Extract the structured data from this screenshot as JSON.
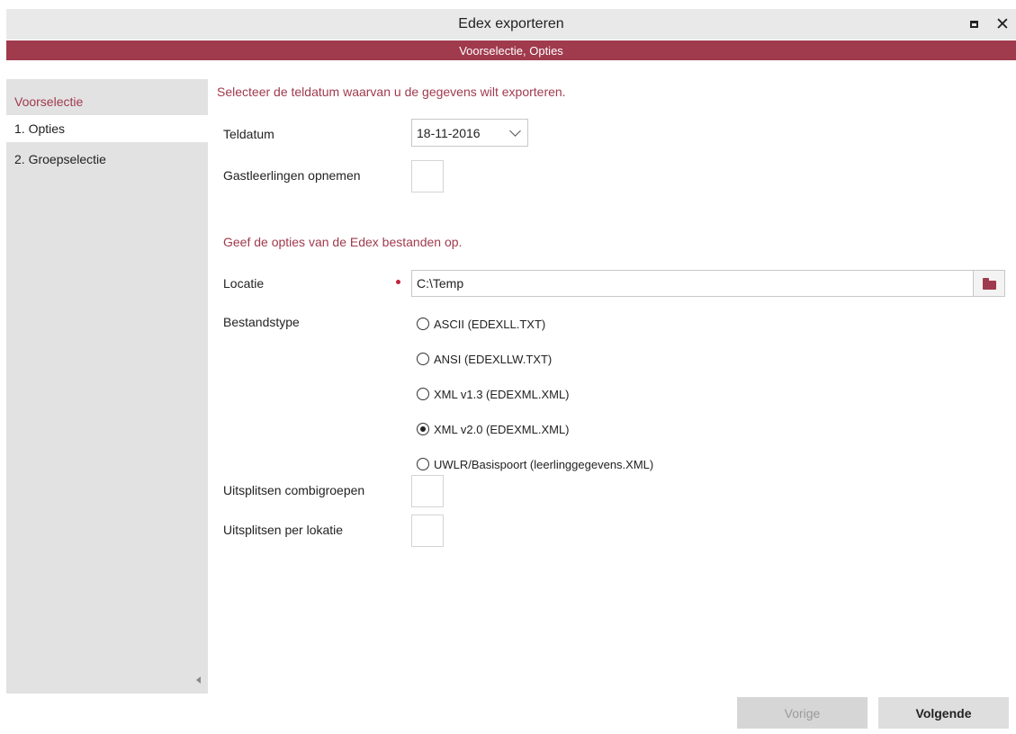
{
  "window": {
    "title": "Edex exporteren",
    "subtitle": "Voorselectie, Opties",
    "accent_color": "#a03a4d"
  },
  "sidebar": {
    "heading": "Voorselectie",
    "items": [
      {
        "label": "1. Opties",
        "active": true
      },
      {
        "label": "2. Groepselectie",
        "active": false
      }
    ]
  },
  "main": {
    "section1_title": "Selecteer de teldatum waarvan u de gegevens wilt exporteren.",
    "teldatum_label": "Teldatum",
    "teldatum_value": "18-11-2016",
    "gastleerlingen_label": "Gastleerlingen opnemen",
    "gastleerlingen_checked": false,
    "section2_title": "Geef de opties van de Edex bestanden op.",
    "locatie_label": "Locatie",
    "locatie_value": "C:\\Temp",
    "locatie_required": true,
    "bestandstype_label": "Bestandstype",
    "bestandstype_options": [
      {
        "label": "ASCII  (EDEXLL.TXT)",
        "checked": false
      },
      {
        "label": "ANSI   (EDEXLLW.TXT)",
        "checked": false
      },
      {
        "label": "XML v1.3 (EDEXML.XML)",
        "checked": false
      },
      {
        "label": "XML v2.0 (EDEXML.XML)",
        "checked": true
      },
      {
        "label": "UWLR/Basispoort (leerlinggegevens.XML)",
        "checked": false
      }
    ],
    "combigroepen_label": "Uitsplitsen combigroepen",
    "combigroepen_checked": false,
    "per_lokatie_label": "Uitsplitsen per lokatie",
    "per_lokatie_checked": false
  },
  "footer": {
    "prev_label": "Vorige",
    "prev_enabled": false,
    "next_label": "Volgende"
  }
}
